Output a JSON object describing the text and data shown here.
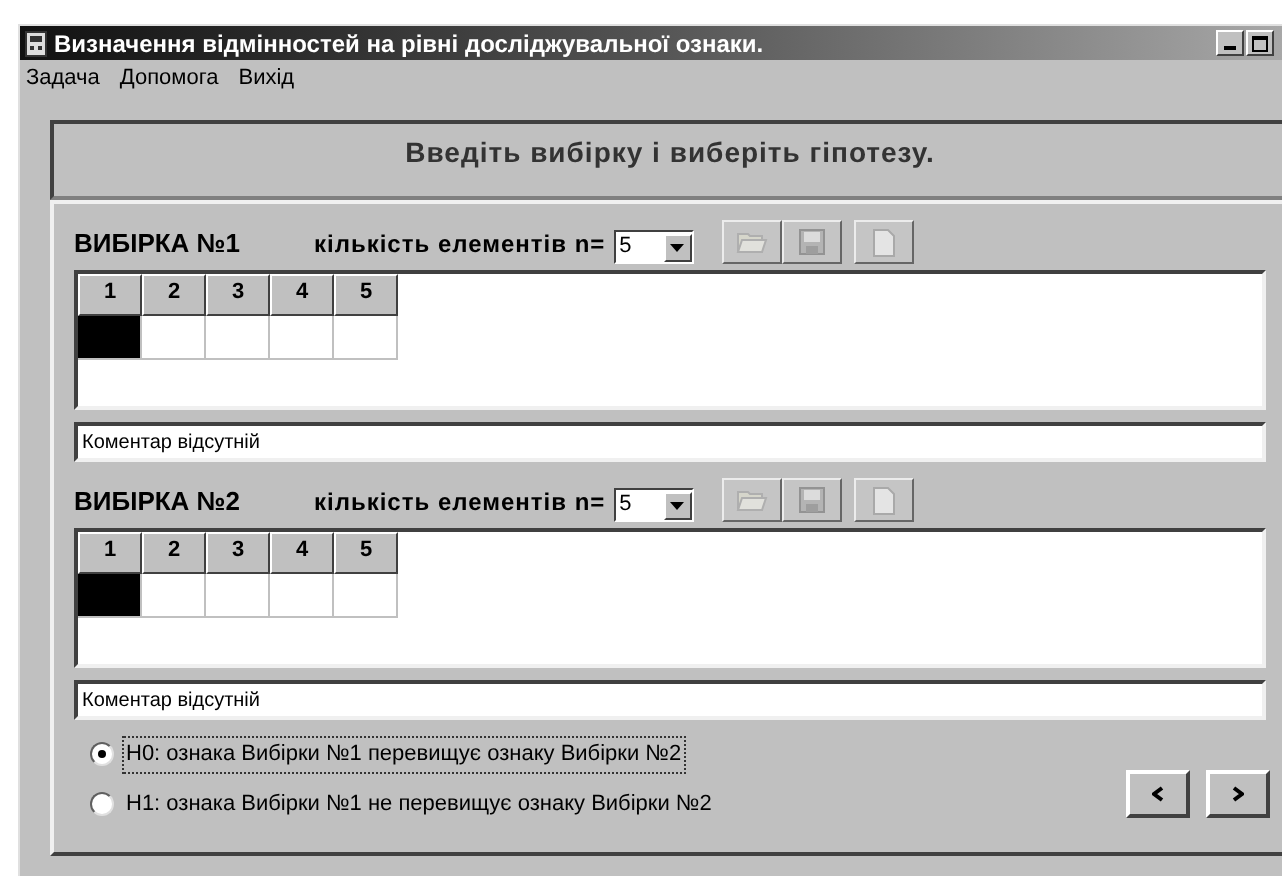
{
  "window": {
    "title": "Визначення відмінностей на рівні досліджувальної ознаки."
  },
  "menu": [
    "Задача",
    "Допомога",
    "Вихід"
  ],
  "header": "Введіть вибірку і виберіть гіпотезу.",
  "samples": [
    {
      "title": "ВИБІРКА №1",
      "count_label": "кількість елементів n=",
      "count_value": "5",
      "tools": [
        {
          "kind": "open",
          "disabled": true
        },
        {
          "kind": "save",
          "disabled": true
        },
        {
          "kind": "new",
          "disabled": true
        }
      ],
      "columns": [
        "1",
        "2",
        "3",
        "4",
        "5"
      ],
      "cells": [
        {
          "selected": true
        },
        {
          "selected": false
        },
        {
          "selected": false
        },
        {
          "selected": false
        },
        {
          "selected": false
        }
      ],
      "comment": "Коментар відсутній"
    },
    {
      "title": "ВИБІРКА №2",
      "count_label": "кількість елементів n=",
      "count_value": "5",
      "tools": [
        {
          "kind": "open",
          "disabled": true
        },
        {
          "kind": "save",
          "disabled": true
        },
        {
          "kind": "new",
          "disabled": true
        }
      ],
      "columns": [
        "1",
        "2",
        "3",
        "4",
        "5"
      ],
      "cells": [
        {
          "selected": true
        },
        {
          "selected": false
        },
        {
          "selected": false
        },
        {
          "selected": false
        },
        {
          "selected": false
        }
      ],
      "comment": "Коментар відсутній"
    }
  ],
  "hypotheses": [
    {
      "label": "H0: ознака Вибірки №1 перевищує ознаку Вибірки №2",
      "selected": true,
      "focused": true
    },
    {
      "label": "H1: ознака Вибірки №1 не перевищує ознаку Вибірки №2",
      "selected": false,
      "focused": false
    }
  ],
  "nav": [
    {
      "kind": "prev"
    },
    {
      "kind": "next"
    }
  ]
}
